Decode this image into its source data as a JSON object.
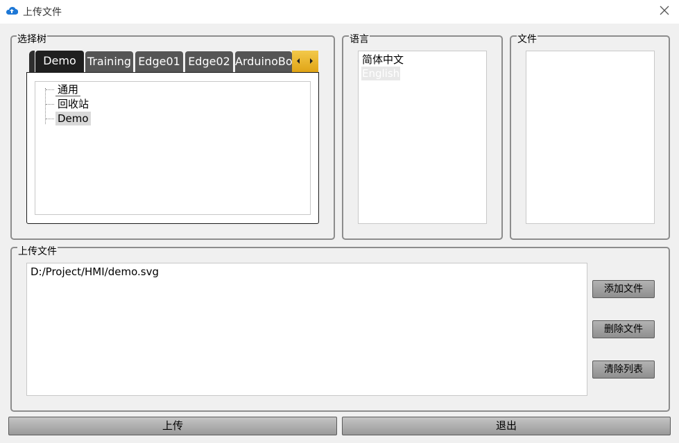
{
  "window": {
    "title": "上传文件",
    "icon": "cloud-upload-icon",
    "close_icon": "close-icon"
  },
  "tree_group": {
    "title": "选择树",
    "tabs": [
      "Demo",
      "Training",
      "Edge01",
      "Edge02",
      "ArduinoBo"
    ],
    "active_tab": "Demo",
    "tree_items": [
      "通用",
      "回收站",
      "Demo"
    ],
    "selected_item": "Demo"
  },
  "language_group": {
    "title": "语言",
    "items": [
      "简体中文",
      "English"
    ],
    "selected_item": "English"
  },
  "file_group": {
    "title": "文件",
    "items": []
  },
  "upload_group": {
    "title": "上传文件",
    "files": [
      "D:/Project/HMI/demo.svg"
    ],
    "add_button": "添加文件",
    "delete_button": "删除文件",
    "clear_button": "清除列表"
  },
  "footer": {
    "upload_button": "上传",
    "exit_button": "退出"
  },
  "colors": {
    "tab_bg": "#555555",
    "tab_active_bg": "#1f1f1f",
    "scroll_accent": "#e8b227",
    "accent": "#1e78d6"
  }
}
